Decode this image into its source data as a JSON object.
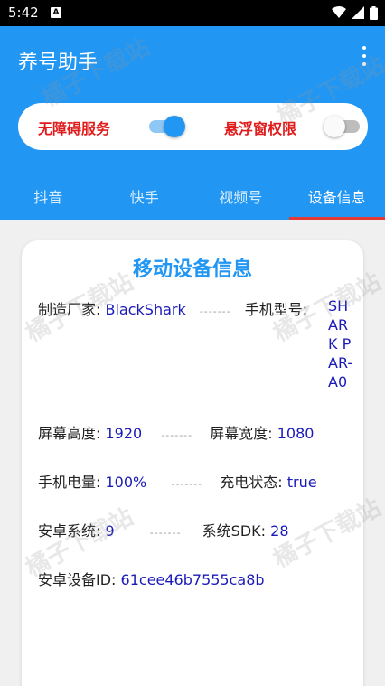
{
  "status_bar": {
    "time": "5:42",
    "notif_glyph": "A"
  },
  "header": {
    "title": "养号助手"
  },
  "toggles": [
    {
      "label": "无障碍服务",
      "state": "on"
    },
    {
      "label": "悬浮窗权限",
      "state": "off"
    }
  ],
  "tabs": [
    {
      "label": "抖音"
    },
    {
      "label": "快手"
    },
    {
      "label": "视频号"
    },
    {
      "label": "设备信息",
      "active": true
    }
  ],
  "device": {
    "title": "移动设备信息",
    "separator": "-------",
    "manufacturer_label": "制造厂家:",
    "manufacturer": "BlackShark",
    "model_label": "手机型号:",
    "model": "SHARK PAR-A0",
    "screen_height_label": "屏幕高度:",
    "screen_height": "1920",
    "screen_width_label": "屏幕宽度:",
    "screen_width": "1080",
    "battery_label": "手机电量:",
    "battery": "100%",
    "charging_label": "充电状态:",
    "charging": "true",
    "android_label": "安卓系统:",
    "android": "9",
    "sdk_label": "系统SDK:",
    "sdk": "28",
    "device_id_label": "安卓设备ID:",
    "device_id": "61cee46b7555ca8b"
  },
  "watermark": "橘子下载站",
  "colors": {
    "primary": "#2196f3",
    "accent_red": "#e01c1c",
    "value_blue": "#1a1ab8",
    "tab_indicator": "#e53935"
  }
}
